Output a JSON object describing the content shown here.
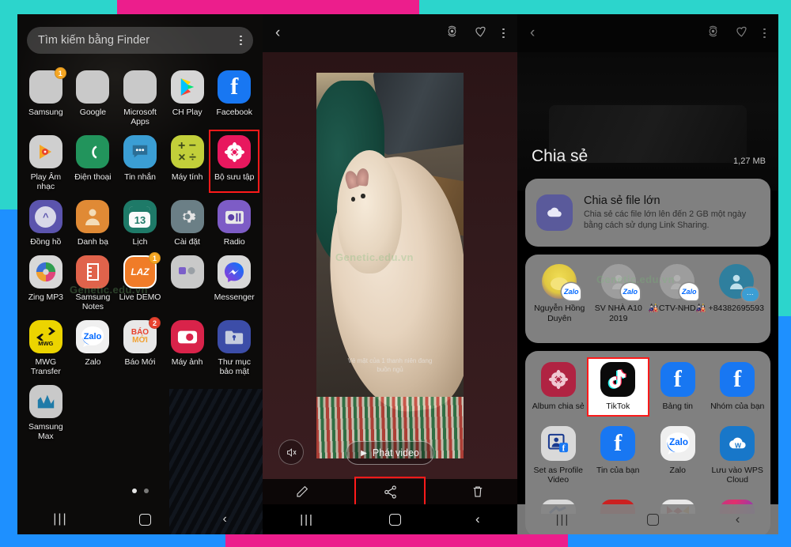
{
  "bands": {
    "teal": "#2cd5cc",
    "blue": "#1e90ff",
    "pink": "#ec1e8c"
  },
  "watermark": "Genetic.edu.vn",
  "home": {
    "search": {
      "placeholder": "Tìm kiếm bằng Finder",
      "menu_icon": "kebab-menu-icon"
    },
    "apps": [
      {
        "label": "Samsung",
        "icon": "samsung-folder-icon",
        "badge": "1"
      },
      {
        "label": "Google",
        "icon": "google-folder-icon",
        "badge": ""
      },
      {
        "label": "Microsoft Apps",
        "icon": "microsoft-folder-icon",
        "badge": ""
      },
      {
        "label": "CH Play",
        "icon": "play-store-icon",
        "badge": ""
      },
      {
        "label": "Facebook",
        "icon": "facebook-icon",
        "badge": ""
      },
      {
        "label": "Play Âm nhạc",
        "icon": "play-music-icon",
        "badge": ""
      },
      {
        "label": "Điện thoại",
        "icon": "phone-icon",
        "badge": ""
      },
      {
        "label": "Tin nhắn",
        "icon": "messages-icon",
        "badge": ""
      },
      {
        "label": "Máy tính",
        "icon": "calculator-icon",
        "badge": ""
      },
      {
        "label": "Bộ sưu tập",
        "icon": "gallery-icon",
        "badge": "",
        "highlight": true
      },
      {
        "label": "Đồng hồ",
        "icon": "clock-icon",
        "badge": ""
      },
      {
        "label": "Danh bạ",
        "icon": "contacts-icon",
        "badge": ""
      },
      {
        "label": "Lịch",
        "icon": "calendar-icon",
        "badge": "",
        "day": "13"
      },
      {
        "label": "Cài đặt",
        "icon": "settings-gear-icon",
        "badge": ""
      },
      {
        "label": "Radio",
        "icon": "radio-icon",
        "badge": ""
      },
      {
        "label": "Zing MP3",
        "icon": "zing-mp3-icon",
        "badge": ""
      },
      {
        "label": "Samsung Notes",
        "icon": "samsung-notes-icon",
        "badge": ""
      },
      {
        "label": "Live DEMO",
        "icon": "lazada-live-icon",
        "badge": "1"
      },
      {
        "label": "",
        "icon": "blank-folder-icon",
        "badge": ""
      },
      {
        "label": "Messenger",
        "icon": "messenger-icon",
        "badge": ""
      },
      {
        "label": "MWG Transfer",
        "icon": "mwg-transfer-icon",
        "badge": ""
      },
      {
        "label": "Zalo",
        "icon": "zalo-icon",
        "badge": ""
      },
      {
        "label": "Báo Mới",
        "icon": "bao-moi-icon",
        "badge": "2"
      },
      {
        "label": "Máy ảnh",
        "icon": "camera-icon",
        "badge": ""
      },
      {
        "label": "Thư mục bảo mật",
        "icon": "secure-folder-icon",
        "badge": ""
      },
      {
        "label": "Samsung Max",
        "icon": "samsung-max-icon",
        "badge": ""
      }
    ],
    "page_indicator": {
      "current": 1,
      "total": 2
    },
    "nav": {
      "recent": "|||",
      "home": "home-square-icon",
      "back": "‹"
    }
  },
  "video": {
    "topbar": {
      "back_icon": "back-chevron-icon",
      "motion_icon": "motion-photo-icon",
      "favorite_icon": "heart-icon",
      "more_icon": "kebab-menu-icon"
    },
    "caption_line1": "Vẻ mặt của 1 thanh niên đang",
    "caption_line2": "buồn ngủ",
    "mute_icon": "mute-speaker-icon",
    "play_label": "Phát video",
    "play_icon": "play-triangle-icon",
    "tools": [
      {
        "name": "edit",
        "icon": "pencil-icon",
        "highlight": false
      },
      {
        "name": "share",
        "icon": "share-icon",
        "highlight": true
      },
      {
        "name": "delete",
        "icon": "trash-icon",
        "highlight": false
      }
    ],
    "nav": {
      "recent": "|||",
      "home": "home-square-icon",
      "back": "‹"
    }
  },
  "share": {
    "topbar": {
      "back_icon": "back-chevron-icon",
      "motion_icon": "motion-photo-icon",
      "favorite_icon": "heart-icon",
      "more_icon": "kebab-menu-icon"
    },
    "title": "Chia sẻ",
    "file_size": "1,27 MB",
    "link_sharing": {
      "icon": "link-sharing-cloud-icon",
      "title": "Chia sẻ file lớn",
      "subtitle": "Chia sẻ các file lớn lên đến 2 GB một ngày bằng cách sử dụng Link Sharing."
    },
    "contacts": [
      {
        "label": "Nguyễn Hồng Duyên",
        "icon": "zalo-contact-avatar",
        "badge": "Zalo"
      },
      {
        "label": "SV NHÀ A10 2019",
        "icon": "zalo-contact-avatar",
        "badge": "Zalo"
      },
      {
        "label": "🎎CTV-NHD🎎",
        "icon": "zalo-contact-avatar",
        "badge": "Zalo"
      },
      {
        "label": "+84382695593",
        "icon": "message-contact-avatar",
        "badge": ""
      }
    ],
    "apps_row1": [
      {
        "label": "Album chia sẻ",
        "icon": "shared-album-icon",
        "highlight": false
      },
      {
        "label": "TikTok",
        "icon": "tiktok-icon",
        "highlight": true
      },
      {
        "label": "Bảng tin",
        "icon": "facebook-feed-icon",
        "highlight": false
      },
      {
        "label": "Nhóm của bạn",
        "icon": "facebook-group-icon",
        "highlight": false
      }
    ],
    "apps_row2": [
      {
        "label": "Set as Profile Video",
        "icon": "profile-video-icon",
        "highlight": false
      },
      {
        "label": "Tin của bạn",
        "icon": "facebook-story-icon",
        "highlight": false
      },
      {
        "label": "Zalo",
        "icon": "zalo-icon",
        "highlight": false
      },
      {
        "label": "Lưu vào WPS Cloud",
        "icon": "wps-cloud-icon",
        "highlight": false
      }
    ],
    "apps_row3": [
      {
        "label": "",
        "icon": "messenger-partial-icon"
      },
      {
        "label": "",
        "icon": "youtube-partial-icon"
      },
      {
        "label": "",
        "icon": "gmail-partial-icon"
      },
      {
        "label": "",
        "icon": "instagram-partial-icon"
      }
    ],
    "nav": {
      "recent": "|||",
      "home": "home-square-icon",
      "back": "‹"
    }
  }
}
